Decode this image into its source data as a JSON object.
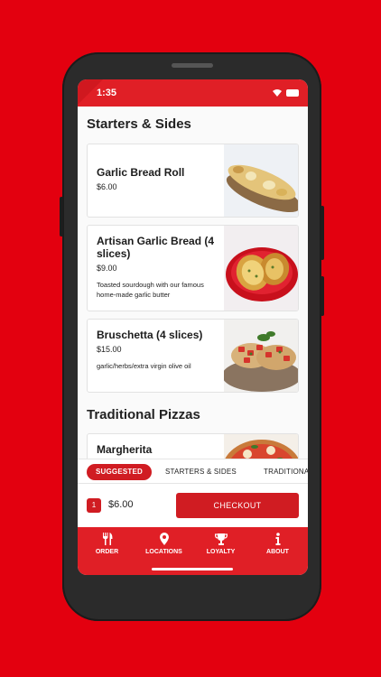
{
  "status": {
    "time": "1:35"
  },
  "sections": {
    "starters_title": "Starters & Sides",
    "pizzas_title": "Traditional Pizzas"
  },
  "items": [
    {
      "name": "Garlic Bread Roll",
      "price": "$6.00",
      "desc": ""
    },
    {
      "name": "Artisan Garlic Bread (4 slices)",
      "price": "$9.00",
      "desc": "Toasted sourdough with our famous home-made garlic butter"
    },
    {
      "name": "Bruschetta (4 slices)",
      "price": "$15.00",
      "desc": "garlic/herbs/extra virgin olive oil"
    },
    {
      "name": "Margherita",
      "price": "",
      "desc": ""
    }
  ],
  "tabs": [
    "SUGGESTED",
    "STARTERS & SIDES",
    "TRADITIONAL PIZZAS"
  ],
  "cart": {
    "qty": "1",
    "total": "$6.00",
    "checkout_label": "CHECKOUT"
  },
  "nav": [
    {
      "label": "ORDER",
      "icon": "fork-knife-icon"
    },
    {
      "label": "LOCATIONS",
      "icon": "map-pin-icon"
    },
    {
      "label": "LOYALTY",
      "icon": "trophy-icon"
    },
    {
      "label": "ABOUT",
      "icon": "info-icon"
    }
  ],
  "colors": {
    "brand_red": "#e01f26",
    "background": "#e3000f",
    "accent": "#d01c22"
  }
}
